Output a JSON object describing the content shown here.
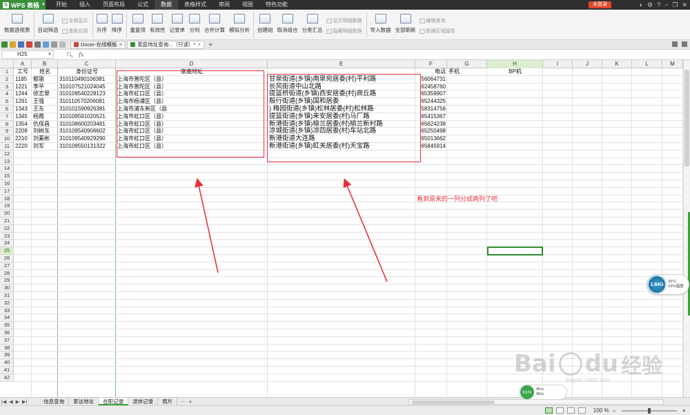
{
  "app": {
    "logo_text": "WPS 表格",
    "menus": [
      "开始",
      "插入",
      "页面布局",
      "公式",
      "数据",
      "表格样式",
      "审阅",
      "视图",
      "特色功能"
    ],
    "active_menu_index": 4,
    "login_label": "未登录"
  },
  "ribbon": {
    "buttons": [
      {
        "label": "数据透视表",
        "icon": "pivot-table-icon"
      },
      {
        "label": "自动筛选",
        "icon": "filter-icon"
      },
      {
        "label": "升序",
        "icon": "sort-asc-icon"
      },
      {
        "label": "降序",
        "icon": "sort-desc-icon"
      },
      {
        "label": "重复项",
        "icon": "duplicate-icon"
      },
      {
        "label": "有效性",
        "icon": "validation-icon"
      },
      {
        "label": "记录单",
        "icon": "record-icon"
      },
      {
        "label": "分列",
        "icon": "split-column-icon"
      },
      {
        "label": "合并计算",
        "icon": "consolidate-icon"
      },
      {
        "label": "模拟分析",
        "icon": "what-if-icon"
      },
      {
        "label": "创建组",
        "icon": "group-icon"
      },
      {
        "label": "取消组合",
        "icon": "ungroup-icon"
      },
      {
        "label": "分类汇总",
        "icon": "subtotal-icon"
      },
      {
        "label": "导入数据",
        "icon": "import-icon"
      },
      {
        "label": "全部刷新",
        "icon": "refresh-icon"
      }
    ],
    "small_filter": [
      "全部显示",
      "重新应用"
    ],
    "small_group": [
      "显示明细数据",
      "隐藏明细数据"
    ],
    "small_query": [
      "编辑查询",
      "数据区域属性"
    ]
  },
  "tabs": {
    "documents": [
      "Docer-在线模板",
      "家庭地址查询...（只读）*"
    ],
    "active_index": 1
  },
  "formula_bar": {
    "cell_ref": "H25",
    "fx_label": "fx",
    "value": ""
  },
  "grid": {
    "columns": [
      "A",
      "B",
      "C",
      "D",
      "E",
      "F",
      "G",
      "H",
      "I",
      "J",
      "K",
      "L",
      "M"
    ],
    "selected_column": "H",
    "selected_row": 25,
    "row_count": 42,
    "header_row": {
      "A": "工号",
      "B": "姓名",
      "C": "身份证号",
      "D": "家庭地址",
      "F": "电话",
      "G": "手机",
      "H": "BP机"
    },
    "rows": [
      {
        "A": "1185",
        "B": "郁丽",
        "C": "310110490106381",
        "D": "上海市普陀区（县）",
        "E": "甘泉街道(乡镇)南泉宛居委(村)平利路",
        "F": "56064731"
      },
      {
        "A": "1221",
        "B": "李平",
        "C": "310107521024045",
        "D": "上海市普陀区（县）",
        "E": "长风街道中山北路",
        "F": "62458760"
      },
      {
        "A": "1244",
        "B": "徐志翠",
        "C": "310109540228123",
        "D": "上海市虹口区（县）",
        "E": "提篮桥街道(乡镇)西安居委(村)商丘路",
        "F": "65359907"
      },
      {
        "A": "1291",
        "B": "王强",
        "C": "310110570206081",
        "D": "上海市杨浦区（县）",
        "E": "殷行街道(乡镇)国和居委",
        "F": "65244325"
      },
      {
        "A": "1343",
        "B": "王东",
        "C": "310101590926381",
        "D": "上海市浦东新区（县",
        "E": ") 梅园街道(乡镇)松林居委(村)松林路",
        "F": "58314756"
      },
      {
        "A": "1345",
        "B": "杨霞",
        "C": "310109591020521",
        "D": "上海市虹口区（县）",
        "E": "提篮街道(乡镇)来安居委(村)马厂路",
        "F": "65415367"
      },
      {
        "A": "1354",
        "B": "仇保昌",
        "C": "310108600203481",
        "D": "上海市虹口区（县）",
        "E": "新港街道(乡镇)榆兰居委(村)榆兰新村路",
        "F": "65624238"
      },
      {
        "A": "2208",
        "B": "刘树东",
        "C": "310109540906602",
        "D": "上海市虹口区（县）",
        "E": "凉城街道(乡镇)凉四居委(村)车站北路",
        "F": "65250498"
      },
      {
        "A": "2210",
        "B": "刘素彬",
        "C": "310109540929290",
        "D": "上海市虹口区（县）",
        "E": "新港街道大连路",
        "F": "65013662"
      },
      {
        "A": "2220",
        "B": "刘军",
        "C": "310109550131322",
        "D": "上海市虹口区（县）",
        "E": "新港街道(乡镇)虹关居委(村)天宝路",
        "F": "65845914"
      }
    ]
  },
  "annotation": "看到原来的一列分成两列了吧",
  "sheets": {
    "tabs": [
      "信息查询",
      "家访地址",
      "在职记录",
      "退休记录",
      "照片"
    ],
    "active_index": 2,
    "more": "···",
    "add": "+"
  },
  "status": {
    "zoom_label": "100 %",
    "zoom_minus": "−",
    "zoom_plus": "+"
  },
  "cpu_widget": {
    "value": "1.84G",
    "temp": "33°C",
    "label": "CPU温度"
  },
  "net_widget": {
    "percent": "61%",
    "up": "0K/s",
    "down": "0K/s"
  },
  "watermark": {
    "brand": "Bai",
    "brand2": "du",
    "cn": "经验",
    "url": "jingyan.baidu.com"
  },
  "colors": {
    "accent_green": "#3aa33a",
    "annotation_red": "#e8303a",
    "logo_green": "#3a8e3a"
  }
}
